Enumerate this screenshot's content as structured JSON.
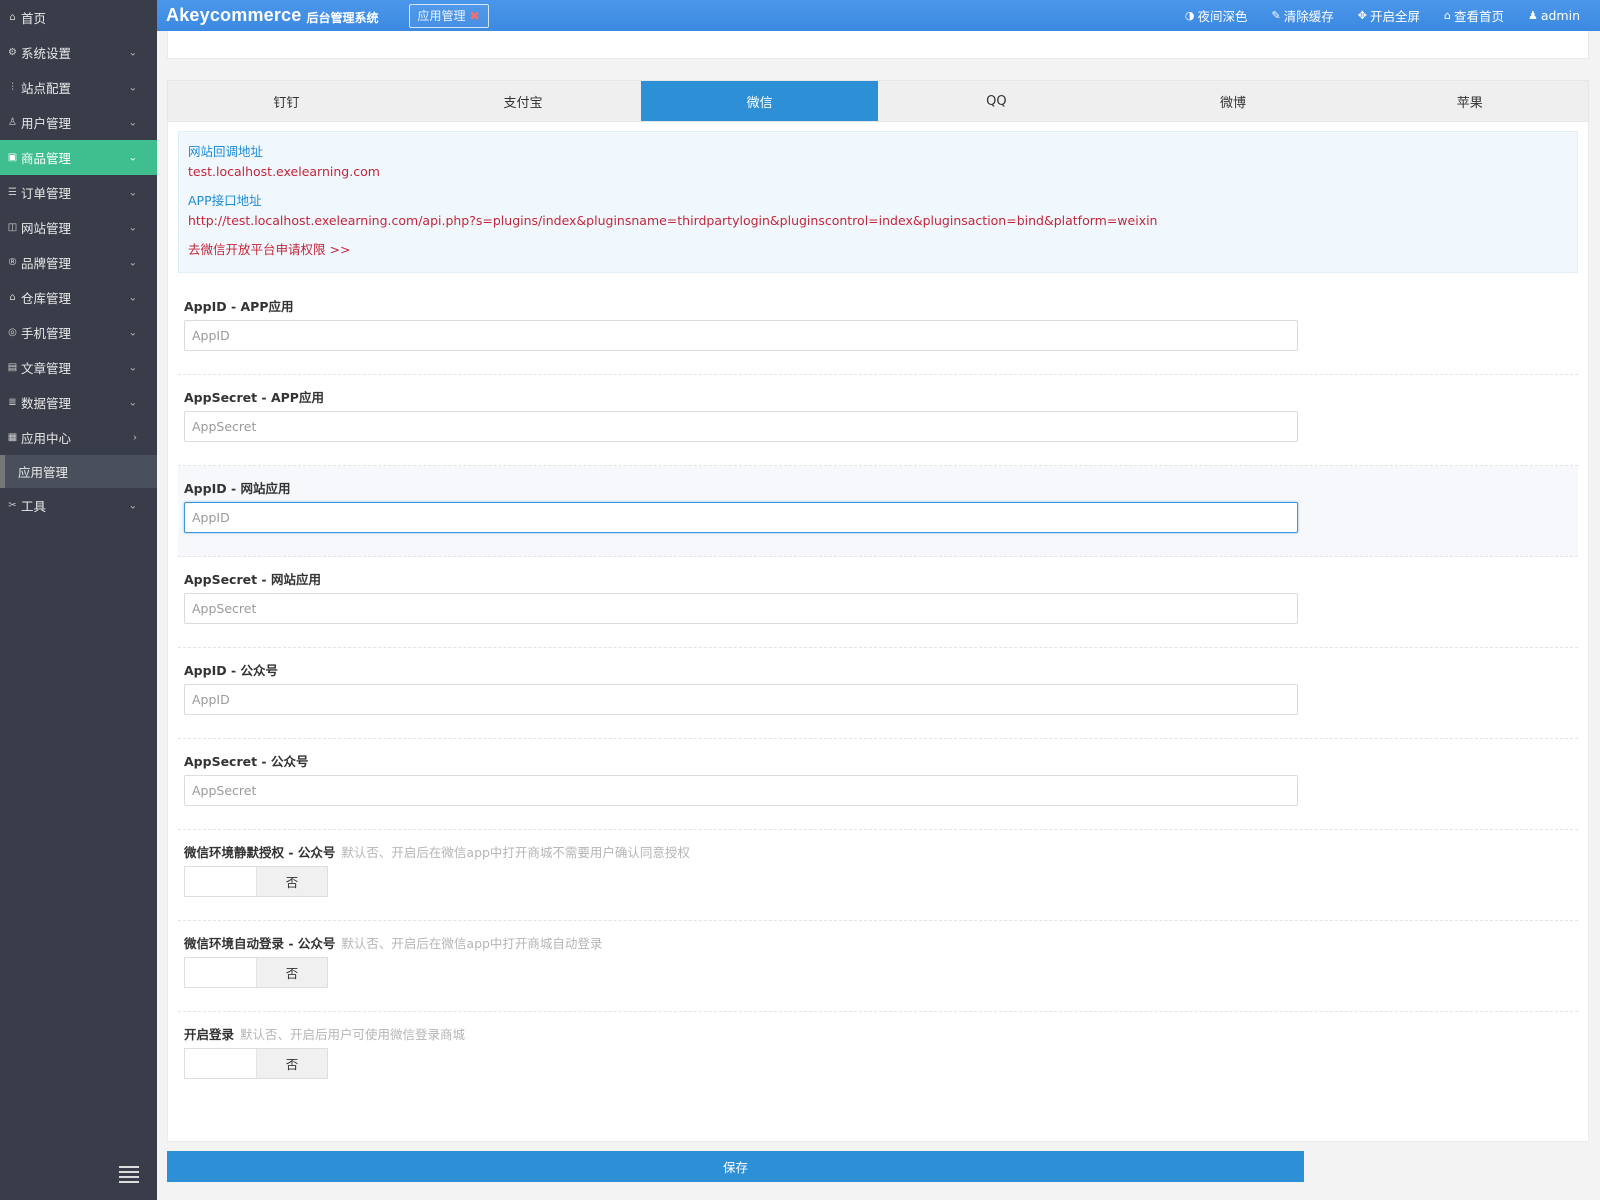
{
  "sidebar": {
    "items": [
      {
        "label": "首页",
        "icon": "home-icon",
        "arrow": ""
      },
      {
        "label": "系统设置",
        "icon": "gear-icon",
        "arrow": "⌄"
      },
      {
        "label": "站点配置",
        "icon": "sliders-icon",
        "arrow": "⌄"
      },
      {
        "label": "用户管理",
        "icon": "user-icon",
        "arrow": "⌄"
      },
      {
        "label": "商品管理",
        "icon": "bag-icon",
        "arrow": "⌄"
      },
      {
        "label": "订单管理",
        "icon": "list-icon",
        "arrow": "⌄"
      },
      {
        "label": "网站管理",
        "icon": "web-icon",
        "arrow": "⌄"
      },
      {
        "label": "品牌管理",
        "icon": "trademark-icon",
        "arrow": "⌄"
      },
      {
        "label": "仓库管理",
        "icon": "warehouse-icon",
        "arrow": "⌄"
      },
      {
        "label": "手机管理",
        "icon": "mobile-icon",
        "arrow": "⌄"
      },
      {
        "label": "文章管理",
        "icon": "document-icon",
        "arrow": "⌄"
      },
      {
        "label": "数据管理",
        "icon": "database-icon",
        "arrow": "⌄"
      },
      {
        "label": "应用中心",
        "icon": "apps-icon",
        "arrow": "›"
      }
    ],
    "sub_item": "应用管理",
    "tools": {
      "label": "工具",
      "icon": "tools-icon",
      "arrow": "⌄"
    }
  },
  "header": {
    "brand": "Akeycommerce",
    "brand_sub": "后台管理系统",
    "open_tab": "应用管理",
    "actions": [
      {
        "label": "夜间深色",
        "icon": "contrast-icon"
      },
      {
        "label": "清除缓存",
        "icon": "brush-icon"
      },
      {
        "label": "开启全屏",
        "icon": "fullscreen-icon"
      },
      {
        "label": "查看首页",
        "icon": "home-icon"
      },
      {
        "label": "admin",
        "icon": "user-icon"
      }
    ]
  },
  "tabs": [
    "钉钉",
    "支付宝",
    "微信",
    "QQ",
    "微博",
    "苹果"
  ],
  "active_tab": "微信",
  "info": {
    "callback_label": "网站回调地址",
    "callback_value": "test.localhost.exelearning.com",
    "api_label": "APP接口地址",
    "api_value": "http://test.localhost.exelearning.com/api.php?s=plugins/index&pluginsname=thirdpartylogin&pluginscontrol=index&pluginsaction=bind&platform=weixin",
    "apply_link": "去微信开放平台申请权限 >>"
  },
  "fields": [
    {
      "label": "AppID - APP应用",
      "placeholder": "AppID",
      "value": ""
    },
    {
      "label": "AppSecret - APP应用",
      "placeholder": "AppSecret",
      "value": ""
    },
    {
      "label": "AppID - 网站应用",
      "placeholder": "AppID",
      "value": ""
    },
    {
      "label": "AppSecret - 网站应用",
      "placeholder": "AppSecret",
      "value": ""
    },
    {
      "label": "AppID - 公众号",
      "placeholder": "AppID",
      "value": ""
    },
    {
      "label": "AppSecret - 公众号",
      "placeholder": "AppSecret",
      "value": ""
    }
  ],
  "switches": [
    {
      "label": "微信环境静默授权 - 公众号",
      "tip": "默认否、开启后在微信app中打开商城不需要用户确认同意授权",
      "state": "否"
    },
    {
      "label": "微信环境自动登录 - 公众号",
      "tip": "默认否、开启后在微信app中打开商城自动登录",
      "state": "否"
    },
    {
      "label": "开启登录",
      "tip": "默认否、开启后用户可使用微信登录商城",
      "state": "否"
    }
  ],
  "save_label": "保存",
  "colors": {
    "sidebar_bg": "#393d49",
    "sidebar_active": "#3fbf8f",
    "header_bg": "#3c89e2",
    "primary": "#2d8fd6",
    "link_red": "#c2263a"
  }
}
